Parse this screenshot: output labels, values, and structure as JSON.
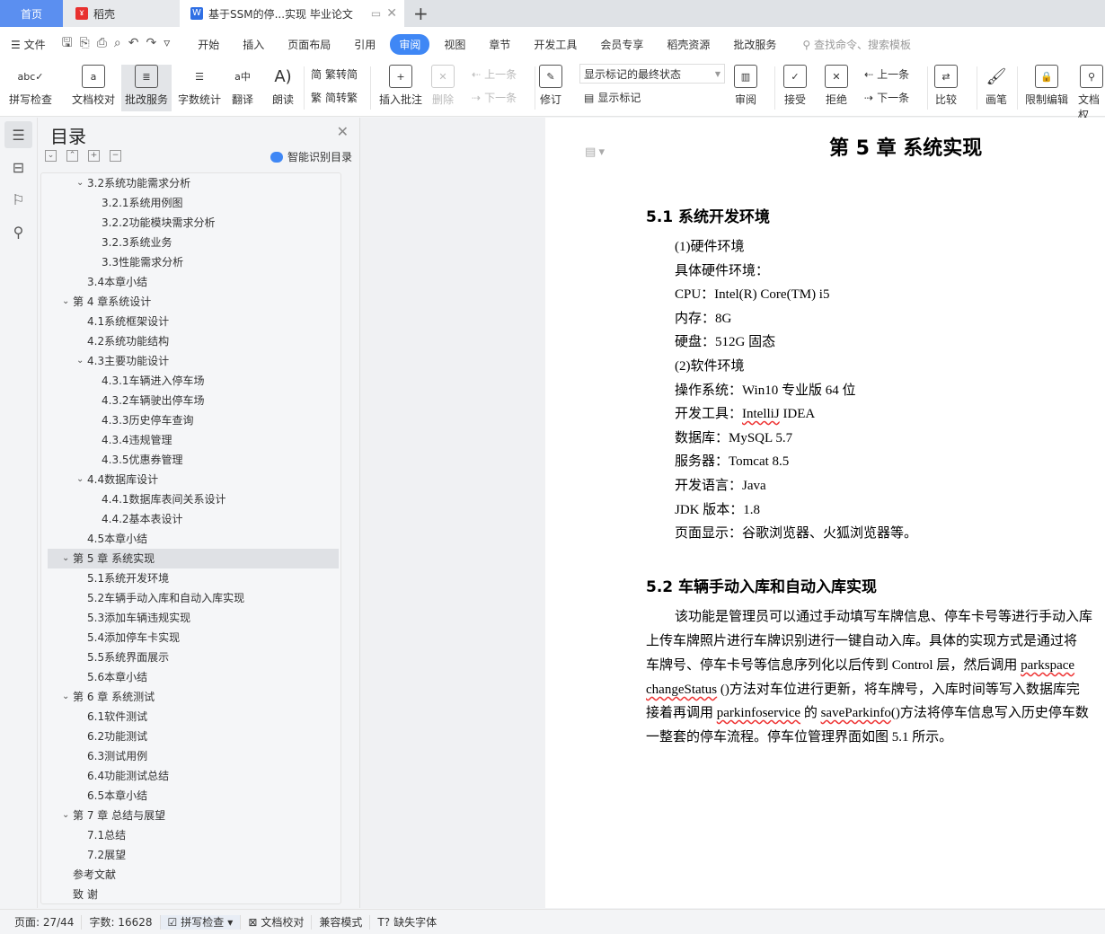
{
  "tabs": {
    "home": "首页",
    "docer": "稻壳",
    "doc": "基于SSM的停...实现 毕业论文",
    "new_tab": "+"
  },
  "menu": {
    "file": "文件",
    "items": [
      "开始",
      "插入",
      "页面布局",
      "引用",
      "审阅",
      "视图",
      "章节",
      "开发工具",
      "会员专享",
      "稻壳资源",
      "批改服务"
    ],
    "active": "审阅",
    "search_placeholder": "查找命令、搜索模板"
  },
  "ribbon": {
    "spell": "拼写检查",
    "proof": "文档校对",
    "correct": "批改服务",
    "wordcount": "字数统计",
    "translate": "翻译",
    "read": "朗读",
    "t2s": "繁转简",
    "s2t": "简转繁",
    "insert_comment": "插入批注",
    "delete": "删除",
    "prev_comment": "上一条",
    "next_comment": "下一条",
    "revise": "修订",
    "display_mode": "显示标记的最终状态",
    "show_marks": "显示标记",
    "review": "审阅",
    "accept": "接受",
    "reject": "拒绝",
    "prev": "上一条",
    "next": "下一条",
    "compare": "比较",
    "pen": "画笔",
    "restrict": "限制编辑",
    "docperm": "文档权"
  },
  "toc": {
    "title": "目录",
    "smart": "智能识别目录",
    "items": [
      {
        "label": "3.2系统功能需求分析",
        "level": 2,
        "toggle": true
      },
      {
        "label": "3.2.1系统用例图",
        "level": 3
      },
      {
        "label": "3.2.2功能模块需求分析",
        "level": 3
      },
      {
        "label": "3.2.3系统业务",
        "level": 3
      },
      {
        "label": "3.3性能需求分析",
        "level": 3
      },
      {
        "label": "3.4本章小结",
        "level": 2
      },
      {
        "label": "第 4 章系统设计",
        "level": 1,
        "toggle": true
      },
      {
        "label": "4.1系统框架设计",
        "level": 2
      },
      {
        "label": "4.2系统功能结构",
        "level": 2
      },
      {
        "label": "4.3主要功能设计",
        "level": 2,
        "toggle": true
      },
      {
        "label": "4.3.1车辆进入停车场",
        "level": 3
      },
      {
        "label": "4.3.2车辆驶出停车场",
        "level": 3
      },
      {
        "label": "4.3.3历史停车查询",
        "level": 3
      },
      {
        "label": "4.3.4违规管理",
        "level": 3
      },
      {
        "label": "4.3.5优惠券管理",
        "level": 3
      },
      {
        "label": "4.4数据库设计",
        "level": 2,
        "toggle": true
      },
      {
        "label": "4.4.1数据库表间关系设计",
        "level": 3
      },
      {
        "label": "4.4.2基本表设计",
        "level": 3
      },
      {
        "label": "4.5本章小结",
        "level": 2
      },
      {
        "label": "第 5 章  系统实现",
        "level": 1,
        "toggle": true,
        "selected": true
      },
      {
        "label": "5.1系统开发环境",
        "level": 2
      },
      {
        "label": "5.2车辆手动入库和自动入库实现",
        "level": 2
      },
      {
        "label": "5.3添加车辆违规实现",
        "level": 2
      },
      {
        "label": "5.4添加停车卡实现",
        "level": 2
      },
      {
        "label": "5.5系统界面展示",
        "level": 2
      },
      {
        "label": "5.6本章小结",
        "level": 2
      },
      {
        "label": "第 6 章  系统测试",
        "level": 1,
        "toggle": true
      },
      {
        "label": "6.1软件测试",
        "level": 2
      },
      {
        "label": "6.2功能测试",
        "level": 2
      },
      {
        "label": "6.3测试用例",
        "level": 2
      },
      {
        "label": "6.4功能测试总结",
        "level": 2
      },
      {
        "label": "6.5本章小结",
        "level": 2
      },
      {
        "label": "第 7 章  总结与展望",
        "level": 1,
        "toggle": true
      },
      {
        "label": "7.1总结",
        "level": 2
      },
      {
        "label": "7.2展望",
        "level": 2
      },
      {
        "label": "参考文献",
        "level": 1
      },
      {
        "label": "致    谢",
        "level": 1
      }
    ]
  },
  "doc": {
    "chapter": "第 5 章  系统实现",
    "h51": "5.1  系统开发环境",
    "env": [
      "(1)硬件环境",
      "具体硬件环境：",
      "CPU：Intel(R) Core(TM) i5",
      "内存：8G",
      "硬盘：512G 固态",
      "(2)软件环境",
      "操作系统：Win10 专业版  64 位",
      "开发工具：IntelliJ IDEA",
      "数据库：MySQL 5.7",
      "服务器：Tomcat 8.5",
      "开发语言：Java",
      "JDK 版本：1.8",
      "页面显示：谷歌浏览器、火狐浏览器等。"
    ],
    "h52": "5.2  车辆手动入库和自动入库实现",
    "para": {
      "l1": "该功能是管理员可以通过手动填写车牌信息、停车卡号等进行手动入库",
      "l2": "上传车牌照片进行车牌识别进行一键自动入库。具体的实现方式是通过将",
      "l3a": "车牌号、停车卡号等信息序列化以后传到 Control 层，然后调用 ",
      "l3b": "parkspace",
      "l4a": "changeStatus",
      "l4b": " ()方法对车位进行更新，将车牌号，入库时间等写入数据库完",
      "l5a": "接着再调用 ",
      "l5b": "parkinfoservice",
      "l5c": " 的 ",
      "l5d": "saveParkinfo",
      "l5e": "()方法将停车信息写入历史停车数",
      "l6": "一整套的停车流程。停车位管理界面如图  5.1 所示。"
    }
  },
  "status": {
    "page": "页面: 27/44",
    "words": "字数: 16628",
    "spell": "拼写检查",
    "proof": "文档校对",
    "compat": "兼容模式",
    "font": "缺失字体"
  }
}
